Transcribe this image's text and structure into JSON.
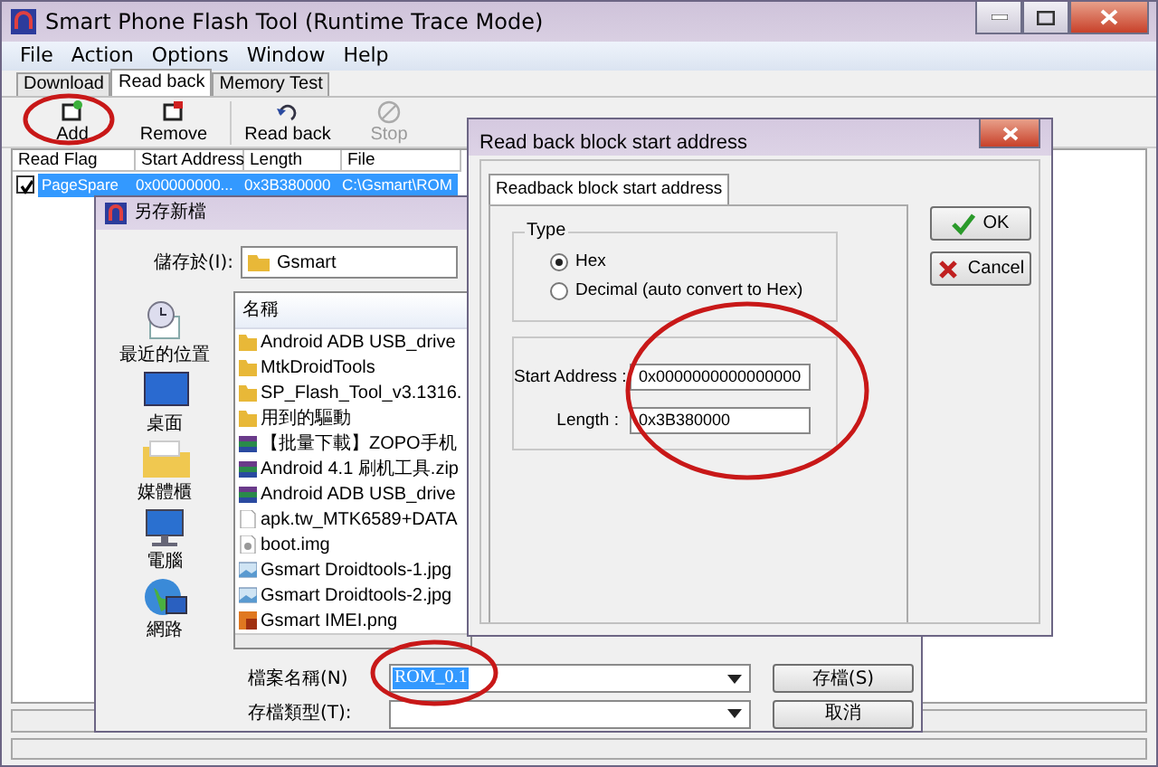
{
  "window": {
    "title": "Smart Phone Flash Tool (Runtime Trace Mode)"
  },
  "menu": [
    "File",
    "Action",
    "Options",
    "Window",
    "Help"
  ],
  "tabs": [
    {
      "label": "Download",
      "selected": false
    },
    {
      "label": "Read back",
      "selected": true
    },
    {
      "label": "Memory Test",
      "selected": false
    }
  ],
  "toolbar": [
    {
      "label": "Add",
      "kind": "add",
      "disabled": false
    },
    {
      "label": "Remove",
      "kind": "remove",
      "disabled": false
    },
    {
      "label": "Read back",
      "kind": "readback",
      "disabled": false
    },
    {
      "label": "Stop",
      "kind": "stop",
      "disabled": true
    }
  ],
  "table": {
    "columns": [
      "Read Flag",
      "Start Address",
      "Length",
      "File"
    ],
    "rows": [
      {
        "checked": true,
        "selected": true,
        "cells": [
          "PageSpare",
          "0x00000000...",
          "0x3B380000",
          "C:\\Gsmart\\ROM"
        ]
      }
    ]
  },
  "save_dialog": {
    "title": "另存新檔",
    "save_in_label": "儲存於(I):",
    "save_in": "Gsmart",
    "places": [
      {
        "label": "最近的位置",
        "kind": "recent"
      },
      {
        "label": "桌面",
        "kind": "desktop"
      },
      {
        "label": "媒體櫃",
        "kind": "library"
      },
      {
        "label": "電腦",
        "kind": "computer"
      },
      {
        "label": "網路",
        "kind": "network"
      }
    ],
    "list_header": "名稱",
    "files": [
      {
        "name": "Android ADB USB_drive",
        "kind": "folder"
      },
      {
        "name": "MtkDroidTools",
        "kind": "folder"
      },
      {
        "name": "SP_Flash_Tool_v3.1316.",
        "kind": "folder"
      },
      {
        "name": "用到的驅動",
        "kind": "folder"
      },
      {
        "name": "【批量下載】ZOPO手机",
        "kind": "archive"
      },
      {
        "name": "Android 4.1 刷机工具.zip",
        "kind": "archive"
      },
      {
        "name": "Android ADB USB_drive",
        "kind": "archive"
      },
      {
        "name": "apk.tw_MTK6589+DATA",
        "kind": "document"
      },
      {
        "name": "boot.img",
        "kind": "disk"
      },
      {
        "name": "Gsmart Droidtools-1.jpg",
        "kind": "image"
      },
      {
        "name": "Gsmart Droidtools-2.jpg",
        "kind": "image"
      },
      {
        "name": "Gsmart IMEI.png",
        "kind": "paint"
      }
    ],
    "filename_label": "檔案名稱(N)",
    "filename": "ROM_0.1",
    "filetype_label": "存檔類型(T):",
    "buttons": [
      "存檔(S)",
      "取消"
    ]
  },
  "readback_dialog": {
    "title": "Read back block start address",
    "tab": "Readback block start address",
    "type_group": "Type",
    "types": [
      {
        "label": "Hex",
        "selected": true
      },
      {
        "label": "Decimal (auto convert to Hex)",
        "selected": false
      }
    ],
    "fields": [
      {
        "label": "Start Address :",
        "value": "0x0000000000000000"
      },
      {
        "label": "Length :",
        "value": "0x3B380000"
      }
    ],
    "buttons": [
      {
        "label": "OK",
        "kind": "ok"
      },
      {
        "label": "Cancel",
        "kind": "cancel"
      }
    ]
  }
}
